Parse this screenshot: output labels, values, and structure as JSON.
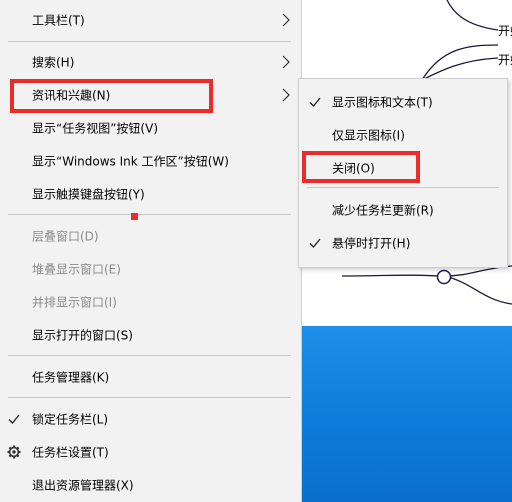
{
  "menu": {
    "toolbars": "工具栏(T)",
    "search": "搜索(H)",
    "news_interests": "资讯和兴趣(N)",
    "show_task_view": "显示“任务视图”按钮(V)",
    "show_ink_workspace": "显示“Windows Ink 工作区”按钮(W)",
    "show_touch_keyboard": "显示触摸键盘按钮(Y)",
    "cascade": "层叠窗口(D)",
    "stacked": "堆叠显示窗口(E)",
    "side_by_side": "并排显示窗口(I)",
    "show_open_windows": "显示打开的窗口(S)",
    "task_manager": "任务管理器(K)",
    "lock_taskbar": "锁定任务栏(L)",
    "taskbar_settings": "任务栏设置(T)",
    "exit_explorer": "退出资源管理器(X)"
  },
  "submenu": {
    "show_icon_text": "显示图标和文本(T)",
    "show_icon_only": "仅显示图标(I)",
    "close": "关闭(O)",
    "reduce_updates": "减少任务栏更新(R)",
    "open_on_hover": "悬停时打开(H)"
  },
  "background": {
    "label_1": "开始",
    "label_2": "开始"
  },
  "colors": {
    "highlight_red": "#ee2b2b",
    "menu_bg": "#f2f2f2",
    "disabled_text": "#8b8b8b",
    "desktop_blue": "#0c7ad8"
  }
}
